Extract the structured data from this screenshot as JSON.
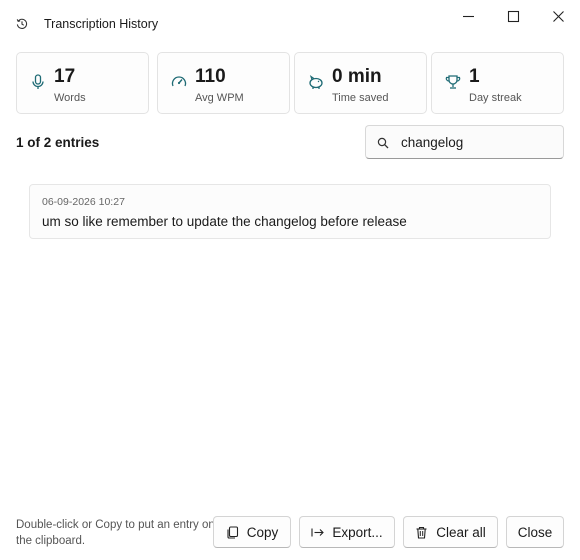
{
  "window": {
    "title": "Transcription History",
    "title_icon": "history-icon"
  },
  "stats": {
    "words": {
      "value": "17",
      "label": "Words",
      "icon": "microphone-icon"
    },
    "wpm": {
      "value": "110",
      "label": "Avg WPM",
      "icon": "speedometer-icon"
    },
    "saved": {
      "value": "0 min",
      "label": "Time saved",
      "icon": "piggy-bank-icon"
    },
    "streak": {
      "value": "1",
      "label": "Day streak",
      "icon": "trophy-icon"
    }
  },
  "list": {
    "count_text": "1 of 2 entries",
    "search_value": "changelog",
    "entries": [
      {
        "timestamp": "06-09-2026 10:27",
        "text": "um so like remember to update the changelog before release"
      }
    ]
  },
  "footer": {
    "hint": "Double-click or Copy to put an entry on the clipboard.",
    "copy_label": "Copy",
    "export_label": "Export...",
    "clear_label": "Clear all",
    "close_label": "Close"
  },
  "colors": {
    "accent_icon": "#1f6b75",
    "border": "#e3e3e3",
    "text": "#1a1a1a"
  }
}
